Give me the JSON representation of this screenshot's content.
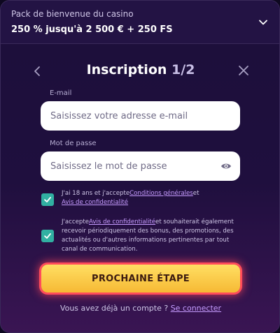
{
  "promo": {
    "label": "Pack de bienvenue du casino",
    "offer": "250 % jusqu'à 2 500 € + 250 FS"
  },
  "header": {
    "title": "Inscription",
    "step": "1/2"
  },
  "email": {
    "label": "E-mail",
    "placeholder": "Saisissez votre adresse e-mail"
  },
  "password": {
    "label": "Mot de passe",
    "placeholder": "Saisissez le mot de passe"
  },
  "consent_terms": {
    "checked": true,
    "text_before": "J'ai 18 ans et j'accepte",
    "terms_link": "Conditions générales",
    "text_middle": "et",
    "privacy_link": "Avis de confidentialité"
  },
  "consent_marketing": {
    "checked": true,
    "text_before": "J'accepte",
    "privacy_link": "Avis de confidentialité",
    "text_after": "et souhaiterait également recevoir périodiquement des bonus, des promotions, des actualités ou d'autres informations pertinentes par tout canal de communication."
  },
  "cta_label": "PROCHAINE ÉTAPE",
  "login": {
    "text": "Vous avez déjà un compte ?",
    "link": "Se connecter"
  },
  "icons": {
    "promo_toggle": "chevron-down-icon",
    "back": "chevron-left-icon",
    "close": "close-icon",
    "password_visibility": "eye-icon",
    "checkbox": "checkmark-icon"
  },
  "colors": {
    "checkbox": "#31b0a2",
    "link": "#c79cff",
    "cta_fill": "#f6b934",
    "cta_glow": "#ff4c5a"
  }
}
